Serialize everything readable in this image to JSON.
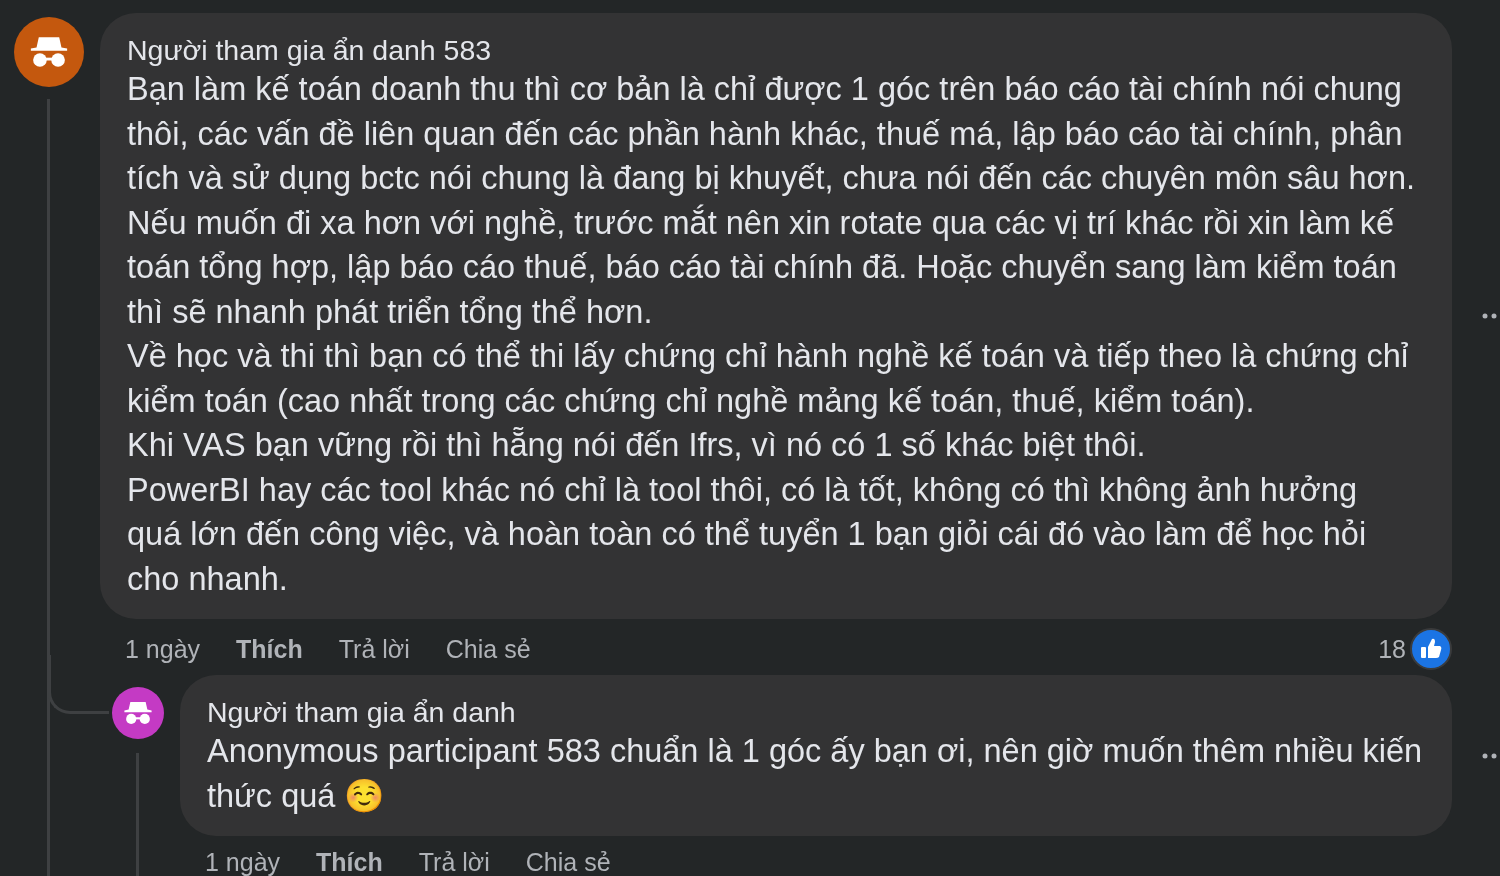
{
  "comments": [
    {
      "author": "Người tham gia ẩn danh 583",
      "color": "#c4580e",
      "paragraphs": [
        "Bạn làm kế toán doanh thu thì cơ bản là chỉ được 1 góc trên báo cáo tài chính nói chung thôi, các vấn đề liên quan đến các phần hành khác, thuế má, lập báo cáo tài chính, phân tích và sử dụng bctc nói chung là đang bị khuyết, chưa nói đến các chuyên môn sâu hơn. Nếu muốn đi xa hơn với nghề, trước mắt nên xin rotate qua các vị trí khác rồi xin làm kế toán tổng hợp, lập báo cáo thuế, báo cáo tài chính đã. Hoặc chuyển sang làm kiểm toán thì sẽ nhanh phát triển tổng thể hơn.",
        "Về học và thi thì bạn có thể thi lấy chứng chỉ hành nghề kế toán và tiếp theo là chứng chỉ kiểm toán (cao nhất trong các chứng chỉ nghề mảng kế toán, thuế, kiểm toán).",
        "Khi VAS bạn vững rồi thì hẵng nói đến Ifrs, vì nó có 1 số khác biệt thôi.",
        "PowerBI hay các tool khác nó chỉ là tool thôi, có là tốt, không có thì không ảnh hưởng quá lớn đến công việc, và hoàn toàn có thể tuyển 1 bạn giỏi cái đó vào làm để học hỏi cho nhanh."
      ],
      "time": "1 ngày",
      "actions": [
        {
          "label": "Thích",
          "kind": "like"
        },
        {
          "label": "Trả lời",
          "kind": "reply"
        },
        {
          "label": "Chia sẻ",
          "kind": "share"
        }
      ],
      "reactions": "18",
      "replies": [
        {
          "author": "Người tham gia ẩn danh",
          "color": "#c43ac4",
          "paragraphs": [
            "Anonymous participant 583 chuẩn là 1 góc ấy bạn ơi, nên giờ muốn thêm nhiều kiến thức quá ☺️"
          ],
          "time": "1 ngày",
          "actions": [
            {
              "label": "Thích",
              "kind": "like"
            },
            {
              "label": "Trả lời",
              "kind": "reply"
            },
            {
              "label": "Chia sẻ",
              "kind": "share"
            }
          ]
        }
      ]
    }
  ]
}
